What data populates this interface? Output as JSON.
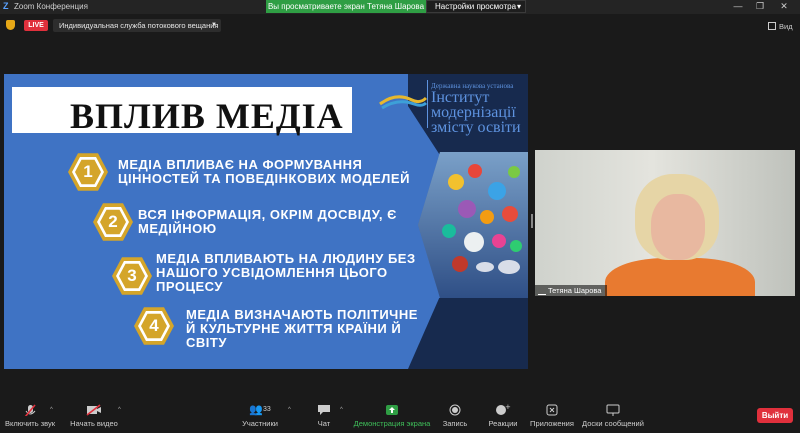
{
  "window": {
    "app_title": "Zoom Конференция"
  },
  "share_banner": {
    "text": "Вы просматриваете экран Тетяна Шарова"
  },
  "view_options": {
    "label": "Настройки просмотра"
  },
  "top": {
    "live_badge": "LIVE",
    "stream_service": "Индивидуальная служба потокового вещания",
    "view_label": "Вид"
  },
  "slide": {
    "title": "ВПЛИВ МЕДІА",
    "institute": {
      "line1": "Державна наукова установа",
      "line2": "Інститут",
      "line3": "модернізації",
      "line4": "змісту освіти"
    },
    "points": [
      {
        "num": "1",
        "text1": "МЕДІА ВПЛИВАЄ НА ФОРМУВАННЯ",
        "text2": "ЦІННОСТЕЙ ТА ПОВЕДІНКОВИХ МОДЕЛЕЙ"
      },
      {
        "num": "2",
        "text1": "ВСЯ ІНФОРМАЦІЯ, ОКРІМ ДОСВІДУ, Є",
        "text2": "МЕДІЙНОЮ"
      },
      {
        "num": "3",
        "text1": "МЕДІА ВПЛИВАЮТЬ НА ЛЮДИНУ БЕЗ",
        "text2": "НАШОГО УСВІДОМЛЕННЯ ЦЬОГО",
        "text3": "ПРОЦЕСУ"
      },
      {
        "num": "4",
        "text1": "МЕДІА ВИЗНАЧАЮТЬ ПОЛІТИЧНЕ",
        "text2": "Й КУЛЬТУРНЕ ЖИТТЯ КРАЇНИ Й",
        "text3": "СВІТУ"
      }
    ]
  },
  "participant": {
    "name": "Тетяна Шарова"
  },
  "toolbar": {
    "mute": "Включить звук",
    "video": "Начать видео",
    "participants": "Участники",
    "participants_count": "33",
    "chat": "Чат",
    "share": "Демонстрация экрана",
    "record": "Запись",
    "reactions": "Реакции",
    "apps": "Приложения",
    "whiteboard": "Доски сообщений",
    "exit": "Выйти"
  },
  "colors": {
    "live": "#e0303c",
    "share_green": "#2f9e44",
    "slide_blue": "#3f73c4",
    "hex_gold": "#d4a52a"
  }
}
